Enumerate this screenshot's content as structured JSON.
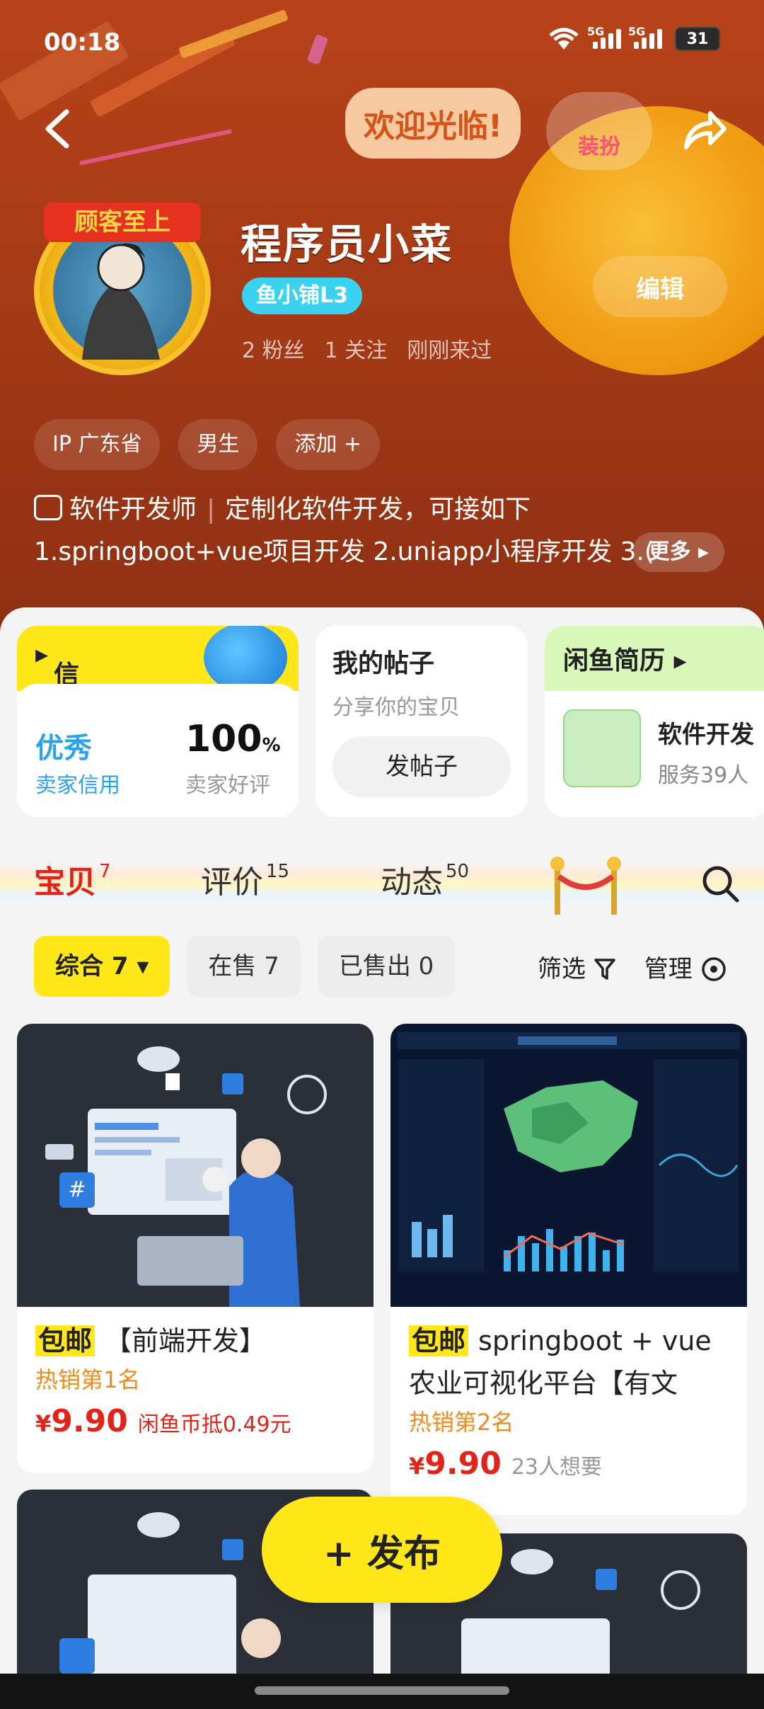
{
  "status_bar": {
    "time": "00:18",
    "net1": "5G",
    "net2": "5G",
    "battery": "31"
  },
  "header": {
    "welcome_bubble": "欢迎光临!",
    "dress_up_label": "装扮",
    "edit_label": "编辑",
    "avatar_badge": "顾客至上",
    "nickname": "程序员小菜",
    "level_badge": "鱼小铺L3",
    "stats": {
      "fans": "2 粉丝",
      "following": "1 关注",
      "last_seen": "刚刚来过"
    }
  },
  "tags": [
    "IP 广东省",
    "男生",
    "添加 +"
  ],
  "bio": {
    "job": "软件开发师",
    "text": "定制化软件开发，可接如下  1.springboot+vue项目开发 2.uniapp小程序开发 3.(",
    "more_label": "更多"
  },
  "cards": {
    "credit": {
      "title": "信用档案",
      "level": "优秀",
      "level_label": "卖家信用",
      "rate": "100",
      "rate_unit": "%",
      "rate_label": "卖家好评"
    },
    "posts": {
      "title": "我的帖子",
      "subtitle": "分享你的宝贝",
      "button": "发帖子"
    },
    "resume": {
      "title": "闲鱼简历",
      "name": "软件开发",
      "meta": "服务39人"
    }
  },
  "tabs": [
    {
      "label": "宝贝",
      "count": "7"
    },
    {
      "label": "评价",
      "count": "15"
    },
    {
      "label": "动态",
      "count": "50"
    }
  ],
  "filters": {
    "chips": [
      "综合 7",
      "在售 7",
      "已售出 0"
    ],
    "filter_label": "筛选",
    "manage_label": "管理"
  },
  "products": [
    {
      "free": "包邮",
      "title": "【前端开发】",
      "rank": "热销第1名",
      "currency": "¥",
      "price": "9.90",
      "extra": "闲鱼币抵0.49元"
    },
    {
      "free": "包邮",
      "title": "springboot + vue 农业可视化平台【有文",
      "rank": "热销第2名",
      "currency": "¥",
      "price": "9.90",
      "extra": "23人想要"
    }
  ],
  "publish_label": "+ 发布",
  "colors": {
    "accent_yellow": "#ffe71a",
    "price_red": "#e2231a",
    "header_bg": "#a53a16"
  }
}
